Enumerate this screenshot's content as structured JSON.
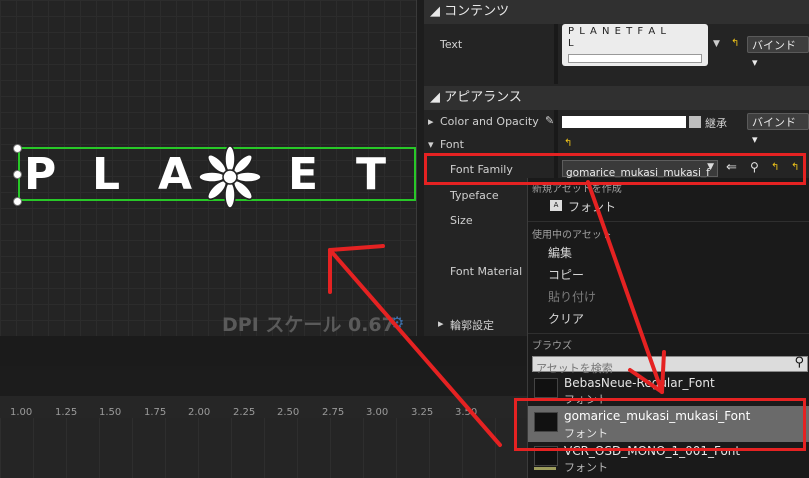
{
  "canvas": {
    "letters": [
      "P",
      "L",
      "A",
      "E",
      "T"
    ],
    "dpi_label": "DPI スケール 0.67"
  },
  "details": {
    "content_section": "コンテンツ",
    "text_label": "Text",
    "text_value_line1": "P L A N E T F A L",
    "text_value_line2": "L",
    "bind_label": "バインド",
    "appearance_section": "アピアランス",
    "color_opacity_label": "Color and Opacity",
    "inherit_label": "継承",
    "font_label": "Font",
    "font_family_label": "Font Family",
    "font_family_value": "gomarice_mukasi_mukasi_f",
    "typeface_label": "Typeface",
    "size_label": "Size",
    "font_material_label": "Font Material",
    "outline_label": "輪郭設定"
  },
  "dropdown": {
    "new_asset_header": "新規アセットを作成",
    "font_create_label": "フォント",
    "current_asset_header": "使用中のアセット",
    "edit": "編集",
    "copy": "コピー",
    "paste": "貼り付け",
    "clear": "クリア",
    "browse_header": "ブラウズ",
    "search_placeholder": "アセットを検索",
    "assets": [
      {
        "name": "BebasNeue-Regular_Font",
        "type": "フォント"
      },
      {
        "name": "gomarice_mukasi_mukasi_Font",
        "type": "フォント"
      },
      {
        "name": "VCR_OSD_MONO_1_001_Font",
        "type": "フォント"
      }
    ]
  },
  "timeline": {
    "ticks": [
      "1.00",
      "1.25",
      "1.50",
      "1.75",
      "2.00",
      "2.25",
      "2.50",
      "2.75",
      "3.00",
      "3.25",
      "3.50"
    ]
  },
  "colors": {
    "annotation": "#e52222",
    "selection": "#28c828",
    "accent": "#f0c419"
  }
}
